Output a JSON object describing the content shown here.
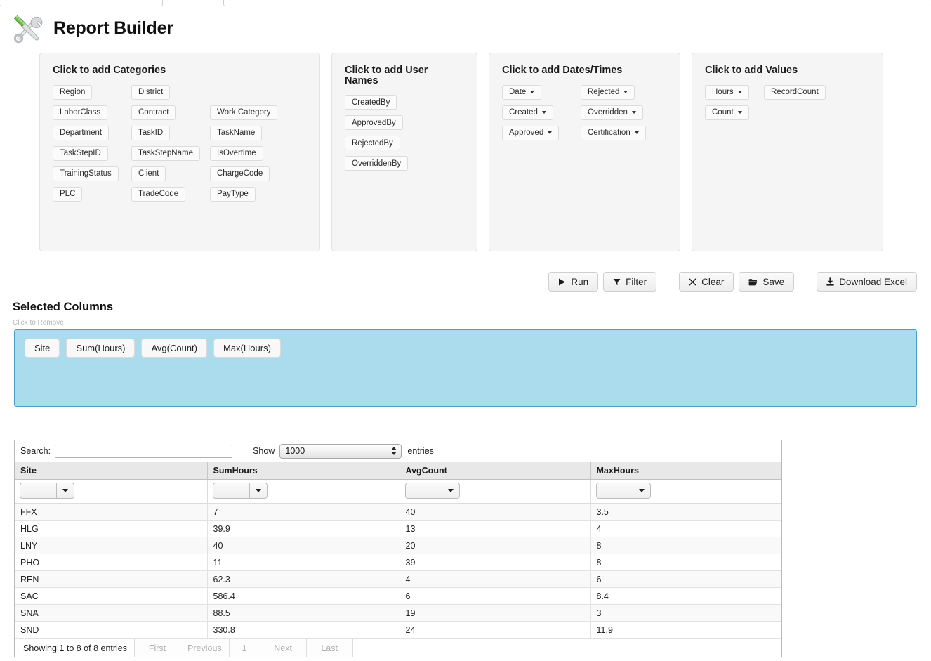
{
  "header": {
    "title": "Report Builder",
    "icon": "tools-icon"
  },
  "panels": [
    {
      "id": "categories",
      "title": "Click to add Categories",
      "columns": 3,
      "chips": [
        {
          "label": "Region",
          "dropdown": false
        },
        {
          "label": "District",
          "dropdown": false
        },
        {
          "label": "",
          "dropdown": false,
          "spacer": true
        },
        {
          "label": "LaborClass",
          "dropdown": false
        },
        {
          "label": "Contract",
          "dropdown": false
        },
        {
          "label": "Work Category",
          "dropdown": false
        },
        {
          "label": "Department",
          "dropdown": false
        },
        {
          "label": "TaskID",
          "dropdown": false
        },
        {
          "label": "TaskName",
          "dropdown": false
        },
        {
          "label": "TaskStepID",
          "dropdown": false
        },
        {
          "label": "TaskStepName",
          "dropdown": false
        },
        {
          "label": "IsOvertime",
          "dropdown": false
        },
        {
          "label": "TrainingStatus",
          "dropdown": false
        },
        {
          "label": "Client",
          "dropdown": false
        },
        {
          "label": "ChargeCode",
          "dropdown": false
        },
        {
          "label": "PLC",
          "dropdown": false
        },
        {
          "label": "TradeCode",
          "dropdown": false
        },
        {
          "label": "PayType",
          "dropdown": false
        }
      ]
    },
    {
      "id": "usernames",
      "title": "Click to add User Names",
      "columns": 1,
      "chips": [
        {
          "label": "CreatedBy",
          "dropdown": false
        },
        {
          "label": "ApprovedBy",
          "dropdown": false
        },
        {
          "label": "RejectedBy",
          "dropdown": false
        },
        {
          "label": "OverriddenBy",
          "dropdown": false
        }
      ]
    },
    {
      "id": "datestimes",
      "title": "Click to add Dates/Times",
      "columns": 2,
      "chips": [
        {
          "label": "Date",
          "dropdown": true
        },
        {
          "label": "Rejected",
          "dropdown": true
        },
        {
          "label": "Created",
          "dropdown": true
        },
        {
          "label": "Overridden",
          "dropdown": true
        },
        {
          "label": "Approved",
          "dropdown": true
        },
        {
          "label": "Certification",
          "dropdown": true
        }
      ]
    },
    {
      "id": "values",
      "title": "Click to add Values",
      "columns": 2,
      "chips": [
        {
          "label": "Hours",
          "dropdown": true
        },
        {
          "label": "RecordCount",
          "dropdown": false
        },
        {
          "label": "Count",
          "dropdown": true
        }
      ]
    }
  ],
  "toolbar": {
    "groups": [
      [
        {
          "label": "Run",
          "icon": "play-icon"
        },
        {
          "label": "Filter",
          "icon": "funnel-icon"
        }
      ],
      [
        {
          "label": "Clear",
          "icon": "x-icon"
        },
        {
          "label": "Save",
          "icon": "folder-icon"
        }
      ],
      [
        {
          "label": "Download Excel",
          "icon": "download-icon"
        }
      ]
    ]
  },
  "selected_columns": {
    "title": "Selected Columns",
    "hint": "Click to Remove",
    "chips": [
      "Site",
      "Sum(Hours)",
      "Avg(Count)",
      "Max(Hours)"
    ],
    "background_color": "#aadcee",
    "border_color": "#4a9ec4"
  },
  "results_table": {
    "search_label": "Search:",
    "search_value": "",
    "search_placeholder": "",
    "show_label": "Show",
    "entries_value": "1000",
    "entries_suffix": "entries",
    "columns": [
      "Site",
      "SumHours",
      "AvgCount",
      "MaxHours"
    ],
    "column_filters": [
      "",
      "",
      "",
      ""
    ],
    "rows": [
      {
        "Site": "FFX",
        "SumHours": "7",
        "AvgCount": "40",
        "MaxHours": "3.5"
      },
      {
        "Site": "HLG",
        "SumHours": "39.9",
        "AvgCount": "13",
        "MaxHours": "4"
      },
      {
        "Site": "LNY",
        "SumHours": "40",
        "AvgCount": "20",
        "MaxHours": "8"
      },
      {
        "Site": "PHO",
        "SumHours": "11",
        "AvgCount": "39",
        "MaxHours": "8"
      },
      {
        "Site": "REN",
        "SumHours": "62.3",
        "AvgCount": "4",
        "MaxHours": "6"
      },
      {
        "Site": "SAC",
        "SumHours": "586.4",
        "AvgCount": "6",
        "MaxHours": "8.4"
      },
      {
        "Site": "SNA",
        "SumHours": "88.5",
        "AvgCount": "19",
        "MaxHours": "3"
      },
      {
        "Site": "SND",
        "SumHours": "330.8",
        "AvgCount": "24",
        "MaxHours": "11.9"
      }
    ],
    "footer_info": "Showing 1 to 8 of 8 entries",
    "pager": [
      "First",
      "Previous",
      "1",
      "Next",
      "Last"
    ]
  }
}
